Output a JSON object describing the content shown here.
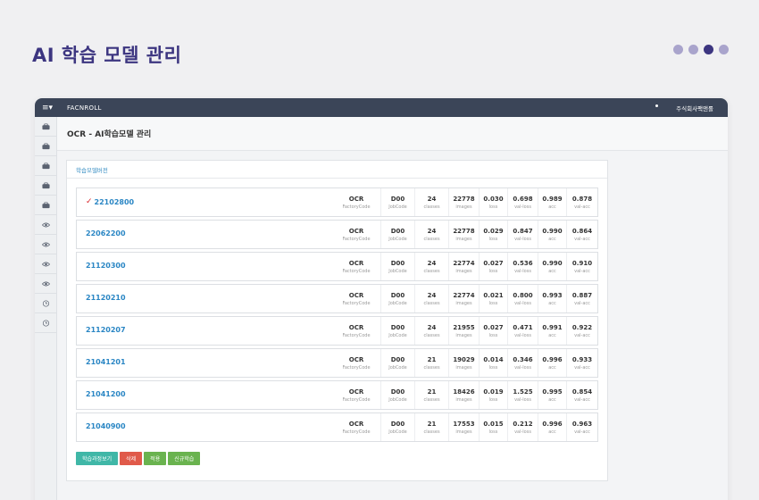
{
  "page_title": "AI 학습 모델 관리",
  "pager": {
    "count": 4,
    "active_index": 2
  },
  "app": {
    "brand": "FACNROLL",
    "user": "주식회사팩앤롤"
  },
  "sidebar": {
    "icons": [
      "briefcase-icon",
      "briefcase-icon",
      "briefcase-icon",
      "briefcase-icon",
      "briefcase-icon",
      "eye-icon",
      "eye-icon",
      "eye-icon",
      "eye-icon",
      "clock-icon",
      "clock-icon"
    ]
  },
  "content": {
    "title": "OCR - AI학습모델 관리",
    "panel_title": "학습모델버전"
  },
  "stat_labels": {
    "factory": "FactoryCode",
    "job": "JobCode",
    "classes": "classes",
    "images": "images",
    "loss": "loss",
    "val_loss": "val-loss",
    "acc": "acc",
    "val_acc": "val-acc"
  },
  "models": [
    {
      "version": "22102800",
      "selected": true,
      "factory": "OCR",
      "job": "D00",
      "classes": "24",
      "images": "22778",
      "loss": "0.030",
      "val_loss": "0.698",
      "acc": "0.989",
      "val_acc": "0.878"
    },
    {
      "version": "22062200",
      "selected": false,
      "factory": "OCR",
      "job": "D00",
      "classes": "24",
      "images": "22778",
      "loss": "0.029",
      "val_loss": "0.847",
      "acc": "0.990",
      "val_acc": "0.864"
    },
    {
      "version": "21120300",
      "selected": false,
      "factory": "OCR",
      "job": "D00",
      "classes": "24",
      "images": "22774",
      "loss": "0.027",
      "val_loss": "0.536",
      "acc": "0.990",
      "val_acc": "0.910"
    },
    {
      "version": "21120210",
      "selected": false,
      "factory": "OCR",
      "job": "D00",
      "classes": "24",
      "images": "22774",
      "loss": "0.021",
      "val_loss": "0.800",
      "acc": "0.993",
      "val_acc": "0.887"
    },
    {
      "version": "21120207",
      "selected": false,
      "factory": "OCR",
      "job": "D00",
      "classes": "24",
      "images": "21955",
      "loss": "0.027",
      "val_loss": "0.471",
      "acc": "0.991",
      "val_acc": "0.922"
    },
    {
      "version": "21041201",
      "selected": false,
      "factory": "OCR",
      "job": "D00",
      "classes": "21",
      "images": "19029",
      "loss": "0.014",
      "val_loss": "0.346",
      "acc": "0.996",
      "val_acc": "0.933"
    },
    {
      "version": "21041200",
      "selected": false,
      "factory": "OCR",
      "job": "D00",
      "classes": "21",
      "images": "18426",
      "loss": "0.019",
      "val_loss": "1.525",
      "acc": "0.995",
      "val_acc": "0.854"
    },
    {
      "version": "21040900",
      "selected": false,
      "factory": "OCR",
      "job": "D00",
      "classes": "21",
      "images": "17553",
      "loss": "0.015",
      "val_loss": "0.212",
      "acc": "0.996",
      "val_acc": "0.963"
    }
  ],
  "buttons": {
    "view_training": "학습과정보기",
    "delete": "삭제",
    "apply": "적용",
    "new_training": "신규학습"
  },
  "colors": {
    "title": "#3c3580",
    "topbar": "#3b4558",
    "link": "#2a86c4",
    "check": "#d9262c",
    "btn_teal": "#40b7a7",
    "btn_red": "#e05a4a",
    "btn_green": "#6ab34f"
  }
}
